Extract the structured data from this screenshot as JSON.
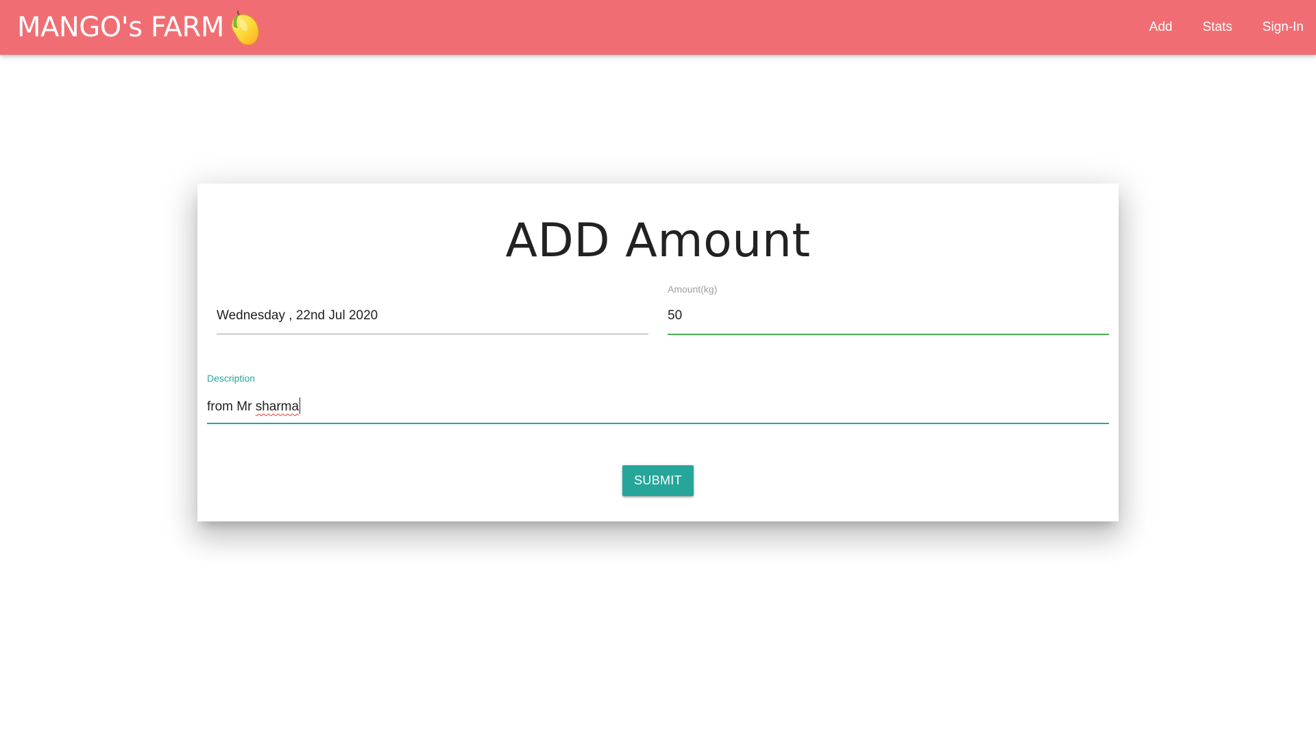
{
  "navbar": {
    "brand": "MANGO's FARM",
    "brand_icon": "mango-icon",
    "background": "#f06e73",
    "links": [
      {
        "label": "Add"
      },
      {
        "label": "Stats"
      },
      {
        "label": "Sign-In"
      }
    ]
  },
  "form": {
    "title": "ADD Amount",
    "date": {
      "value": "Wednesday , 22nd Jul 2020"
    },
    "amount": {
      "label": "Amount(kg)",
      "value": "50",
      "accent": "#4caf50"
    },
    "description": {
      "label": "Description",
      "value_prefix": "from Mr ",
      "value_misspelled": "sharma",
      "accent": "#26a69a"
    },
    "submit_label": "SUBMIT",
    "submit_color": "#26a69a"
  }
}
